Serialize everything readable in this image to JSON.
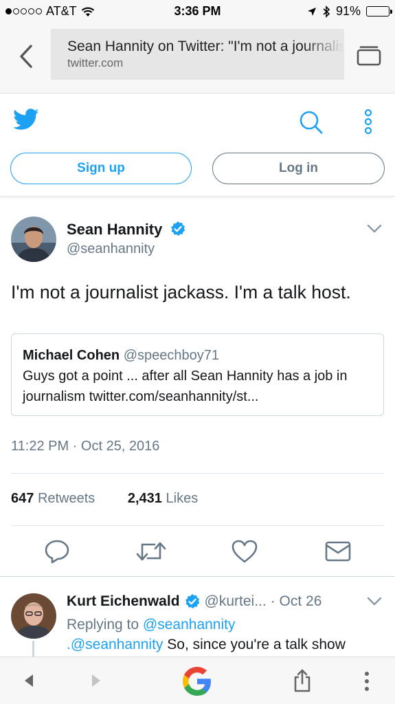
{
  "status_bar": {
    "carrier": "AT&T",
    "time": "3:36 PM",
    "battery_percent": "91%",
    "battery_level": 0.91,
    "signal_bars_filled": 1,
    "signal_bars_total": 5
  },
  "browser": {
    "page_title": "Sean Hannity on Twitter: \"I'm not a journalist jackass. I'm a talk host.\"",
    "domain": "twitter.com"
  },
  "twitter_nav": {
    "signup_label": "Sign up",
    "login_label": "Log in",
    "brand_color": "#1DA1F2"
  },
  "tweet": {
    "author_name": "Sean Hannity",
    "author_handle": "@seanhannity",
    "text": "I'm not a journalist jackass. I'm a talk host.",
    "quote": {
      "author_name": "Michael Cohen",
      "author_handle": "@speechboy71",
      "text": "Guys got a point ... after all Sean Hannity has a job in journalism twitter.com/seanhannity/st..."
    },
    "timestamp": "11:22 PM · Oct 25, 2016",
    "retweets_count": "647",
    "retweets_label": "Retweets",
    "likes_count": "2,431",
    "likes_label": "Likes"
  },
  "reply": {
    "author_name": "Kurt Eichenwald",
    "author_handle": "@kurtei...",
    "date": "· Oct 26",
    "replying_prefix": "Replying to",
    "replying_to": "@seanhannity",
    "text_mention": ".@seanhannity",
    "text": "So, since you're a talk show"
  },
  "icons": {
    "back": "chevron-left-icon",
    "tabs": "tabs-icon",
    "twitter": "twitter-bird-icon",
    "search": "search-icon",
    "more": "vertical-dots-icon",
    "verified": "verified-badge-icon",
    "reply": "reply-icon",
    "retweet": "retweet-icon",
    "like": "heart-icon",
    "message": "envelope-icon",
    "google": "google-logo-icon",
    "share": "share-icon"
  }
}
